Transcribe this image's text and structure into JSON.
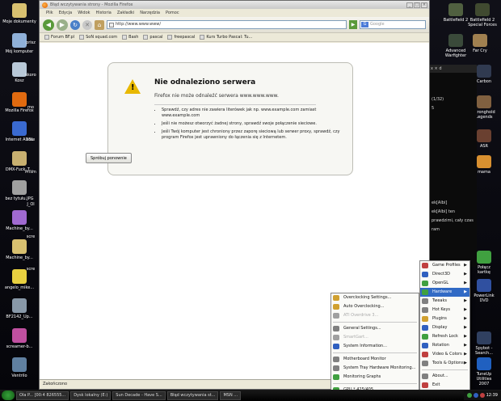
{
  "desktop": {
    "left_icons": [
      {
        "label": "Moje dokumenty",
        "color": "#d8c070"
      },
      {
        "label": "Mój komputer",
        "color": "#8fb0d8"
      },
      {
        "label": "Kosz",
        "color": "#b8c8d8"
      },
      {
        "label": "Mozilla Firefox",
        "color": "#e06a10"
      },
      {
        "label": "Internet ADSL",
        "color": "#3a6ad0"
      },
      {
        "label": "DMX-Fuck_T...",
        "color": "#c8b070"
      },
      {
        "label": "bez tytułu.JPG",
        "color": "#a0a0a0"
      },
      {
        "label": "Machine_by...",
        "color": "#a06ad0"
      },
      {
        "label": "Machine_by...",
        "color": "#d8c070"
      },
      {
        "label": "angelo_mike...",
        "color": "#e8d040"
      },
      {
        "label": "BF2142_Up...",
        "color": "#8898a8"
      },
      {
        "label": "screamer-b...",
        "color": "#c050a0"
      },
      {
        "label": "Ventrilo",
        "color": "#6080a0"
      }
    ],
    "left_icons_col2": [
      "prisz",
      "skoro",
      "mo",
      "scre",
      "Prism",
      "J_Ol",
      "scre",
      "scre"
    ],
    "right_icons": [
      {
        "label": "Battlefield 2",
        "color": "#506040"
      },
      {
        "label": "Battlefield 2 Special Forces",
        "color": "#404a30"
      },
      {
        "label": "Advanced Warfighter",
        "color": "#3a4a3a"
      },
      {
        "label": "Far Cry",
        "color": "#a08050"
      },
      {
        "label": "Carbon",
        "color": "#303a50"
      },
      {
        "label": "Stronghold Legends",
        "color": "#806040"
      },
      {
        "label": "ASR",
        "color": "#6a4030"
      },
      {
        "label": "mama",
        "color": "#d89030"
      },
      {
        "label": "Połącz kartkę",
        "color": "#40a040"
      },
      {
        "label": "PowerLink DVD",
        "color": "#3050a0"
      },
      {
        "label": "Spybot - Search...",
        "color": "#304060"
      },
      {
        "label": "TuneUp Utilities 2007",
        "color": "#2060c0"
      }
    ]
  },
  "firefox": {
    "title": "Błąd wczytywania strony - Mozilla Firefox",
    "menu": [
      "Plik",
      "Edycja",
      "Widok",
      "Historia",
      "Zakładki",
      "Narzędzia",
      "Pomoc"
    ],
    "url": "http://www.www.www/",
    "search_placeholder": "Google",
    "bookmarks": [
      "Forum BF.pl",
      "SoN squad.com",
      "Bash",
      "pascal",
      "freepascal",
      "Kurs Turbo Pascal: Tu..."
    ],
    "status": "Zakończono",
    "error": {
      "title": "Nie odnaleziono serwera",
      "description": "Firefox nie może odnaleźć serwera www.www.www.",
      "bullets": [
        "Sprawdź, czy adres nie zawiera literówek jak np. www.example.com zamiast www.example.com",
        "Jeśli nie możesz otworzyć żadnej strony, sprawdź swoje połączenie sieciowe.",
        "Jeśli Twój komputer jest chroniony przez zaporę sieciową lub serwer proxy, sprawdź, czy program Firefox jest uprawniony do łączenia się z Internetem."
      ],
      "retry_label": "Spróbuj ponownie"
    }
  },
  "darkapp": {
    "lines": [
      "(1/32)",
      "5",
      "ek[Albi]",
      "ek[Albi] ten",
      "prawdzimi, cały czas",
      "ram"
    ]
  },
  "tray_menu": {
    "items": [
      {
        "label": "Game Profiles",
        "arrow": true,
        "color": "#c04040"
      },
      {
        "label": "Direct3D",
        "arrow": true,
        "color": "#3060c0"
      },
      {
        "label": "OpenGL",
        "arrow": true,
        "color": "#40a040"
      },
      {
        "label": "Hardware",
        "arrow": true,
        "color": "#40a040",
        "highlight": true
      },
      {
        "label": "Tweaks",
        "arrow": true,
        "color": "#808080"
      },
      {
        "label": "Hot Keys",
        "arrow": true,
        "color": "#808080"
      },
      {
        "label": "Plugins",
        "arrow": true,
        "color": "#d0a030"
      },
      {
        "label": "Display",
        "arrow": true,
        "color": "#3060c0"
      },
      {
        "label": "Refresh Lock",
        "arrow": true,
        "color": "#40a040"
      },
      {
        "label": "Rotation",
        "arrow": true,
        "color": "#3060c0"
      },
      {
        "label": "Video & Colors",
        "arrow": true,
        "color": "#c04040"
      },
      {
        "label": "Tools & Options",
        "arrow": true,
        "color": "#808080"
      },
      {
        "label": "About...",
        "arrow": false,
        "color": "#808080"
      },
      {
        "label": "Exit",
        "arrow": false,
        "color": "#c04040"
      }
    ]
  },
  "hardware_submenu": {
    "items": [
      {
        "label": "Overclocking Settings...",
        "color": "#d0a030",
        "disabled": false
      },
      {
        "label": "Auto Overclocking...",
        "color": "#d0a030",
        "disabled": false
      },
      {
        "label": "ATI Overdrive 3...",
        "color": "#a0a0a0",
        "disabled": true
      },
      {
        "sep": true
      },
      {
        "label": "General Settings...",
        "color": "#808080",
        "disabled": false
      },
      {
        "label": "SmartGart...",
        "color": "#a0a0a0",
        "disabled": true
      },
      {
        "label": "System Information...",
        "color": "#3060c0",
        "disabled": false
      },
      {
        "sep": true
      },
      {
        "label": "Motherboard Monitor",
        "color": "#808080",
        "disabled": false
      },
      {
        "label": "System Tray Hardware Monitoring...",
        "color": "#808080",
        "disabled": false
      },
      {
        "label": "Monitoring Graphs",
        "color": "#40a040",
        "disabled": false
      },
      {
        "sep": true
      },
      {
        "label": "GPU * 425/405",
        "color": "#40a040",
        "disabled": false
      },
      {
        "label": "System * 398/144",
        "color": "#40a040",
        "disabled": false
      }
    ]
  },
  "taskbar": {
    "items": [
      "Ola P... [00:4 826555...",
      "Dysk lokalny (E:)",
      "Sun Decade - Have S...",
      "Błąd wczytywania st...",
      "MSN ..."
    ],
    "clock": "12:39"
  }
}
